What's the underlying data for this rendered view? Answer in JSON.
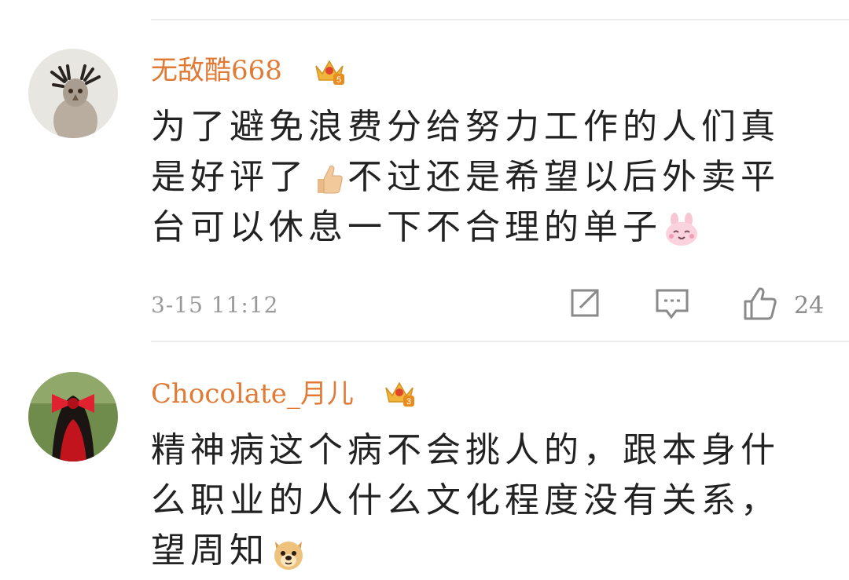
{
  "comments": [
    {
      "username": "无敌酷668",
      "vip_level": "5",
      "text_before_emoji1": "为了避免浪费分给努力工作的人们真是好评了",
      "emoji1": "thumbs-up",
      "text_after_emoji1": "不过还是希望以后外卖平台可以休息一下不合理的单子",
      "emoji2": "smiling-bunny",
      "time": "3-15 11:12",
      "likes": "24"
    },
    {
      "username": "Chocolate_月儿",
      "vip_level": "3",
      "text_before_emoji1": "精神病这个病不会挑人的，跟本身什么职业的人什么文化程度没有关系，望周知",
      "emoji1": "doge"
    }
  ],
  "colors": {
    "username": "#e07a34",
    "text": "#222222",
    "meta": "#9a9a9a",
    "divider": "#ececec",
    "crown": "#f0b53a"
  }
}
